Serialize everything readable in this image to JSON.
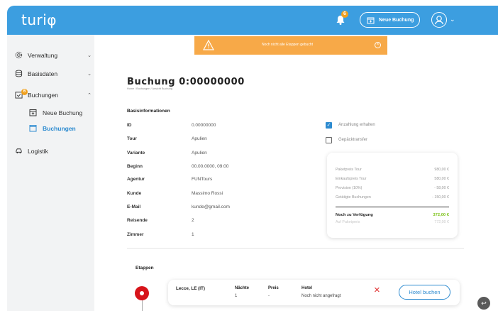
{
  "app": {
    "logo": "turiφ"
  },
  "topbar": {
    "notification_count": "6",
    "new_booking_label": "Neue Buchung",
    "accent": "#3c9ee0"
  },
  "sidebar": {
    "items": [
      {
        "label": "Verwaltung",
        "icon": "settings-icon"
      },
      {
        "label": "Basisdaten",
        "icon": "database-icon"
      },
      {
        "label": "Buchungen",
        "icon": "booking-icon",
        "badge": "6"
      },
      {
        "label": "Logistik",
        "icon": "car-icon"
      }
    ],
    "subitems": [
      {
        "label": "Neue Buchung",
        "icon": "calendar-plus-icon"
      },
      {
        "label": "Buchungen",
        "icon": "calendar-icon",
        "active": true
      }
    ]
  },
  "warning": {
    "text": "Noch nicht alle Etappen gebucht",
    "color": "#f7a948"
  },
  "page": {
    "title": "Buchung 0:00000000",
    "breadcrumb": "Home / Buchungen / Ansicht Buchung"
  },
  "basis": {
    "heading": "Basisinformationen",
    "rows": [
      {
        "label": "ID",
        "value": "0.00000000"
      },
      {
        "label": "Tour",
        "value": "Apulien"
      },
      {
        "label": "Variante",
        "value": "Apulien"
      },
      {
        "label": "Beginn",
        "value": "00.00.0000, 09:00"
      },
      {
        "label": "Agentur",
        "value": "FUNTours"
      },
      {
        "label": "Kunde",
        "value": "Massimo Rossi"
      },
      {
        "label": "E-Mail",
        "value": "kunde@gmail.com"
      },
      {
        "label": "Reisende",
        "value": "2"
      },
      {
        "label": "Zimmer",
        "value": "1"
      }
    ]
  },
  "checks": [
    {
      "label": "Anzahlung erhalten",
      "checked": true
    },
    {
      "label": "Gepäcktransfer",
      "checked": false
    }
  ],
  "summary": {
    "rows": [
      {
        "label": "Paketpreis Tour",
        "value": "980,00 €"
      },
      {
        "label": "Einkaufspreis Tour",
        "value": "580,00 €"
      },
      {
        "label": "Provision (10%)",
        "value": "- 58,00 €"
      },
      {
        "label": "Getätigte Buchungen",
        "value": "- 150,00 €"
      }
    ],
    "available_label": "Noch zu Verfügung",
    "available_value": "372,00 €",
    "ratio_label": "Auf Paketpreis",
    "ratio_value": "772,00 €"
  },
  "stages": {
    "heading": "Etappen",
    "items": [
      {
        "place": "Lecce, LE (IT)",
        "nights_label": "Nächte",
        "nights": "1",
        "price_label": "Preis",
        "price": "-",
        "hotel_label": "Hotel",
        "hotel": "Noch nicht angefragt",
        "book_label": "Hotel buchen"
      }
    ]
  }
}
